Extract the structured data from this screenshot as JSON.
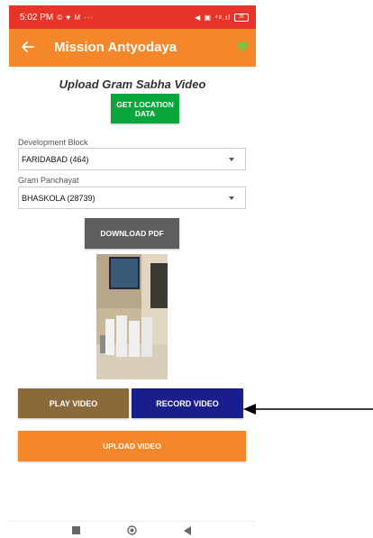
{
  "status_bar": {
    "time": "5:02 PM",
    "left_icons": "© ♥ M ···",
    "right_icons": "◀ ▣ ⁴ᵍ.ıl",
    "battery": "35"
  },
  "app_bar": {
    "title": "Mission Antyodaya",
    "back_icon": "arrow-left-icon",
    "status_icon": "wifi-icon"
  },
  "page": {
    "title": "Upload Gram Sabha Video"
  },
  "buttons": {
    "get_location": "GET LOCATION DATA",
    "download_pdf": "DOWNLOAD PDF",
    "play_video": "PLAY VIDEO",
    "record_video": "RECORD VIDEO",
    "upload_video": "UPLOAD VIDEO"
  },
  "form": {
    "development_block": {
      "label": "Development Block",
      "value": "FARIDABAD (464)"
    },
    "gram_panchayat": {
      "label": "Gram Panchayat",
      "value": "BHASKOLA (28739)"
    }
  },
  "colors": {
    "status_bar": "#e8352a",
    "app_bar": "#f5872b",
    "location_button": "#0aa63c",
    "pdf_button": "#5e5e5e",
    "play_button": "#8a6a3a",
    "record_button": "#1a1e8c",
    "upload_button": "#f5872b"
  },
  "nav": {
    "recent_icon": "square-icon",
    "home_icon": "circle-home-icon",
    "back_icon": "triangle-back-icon"
  }
}
